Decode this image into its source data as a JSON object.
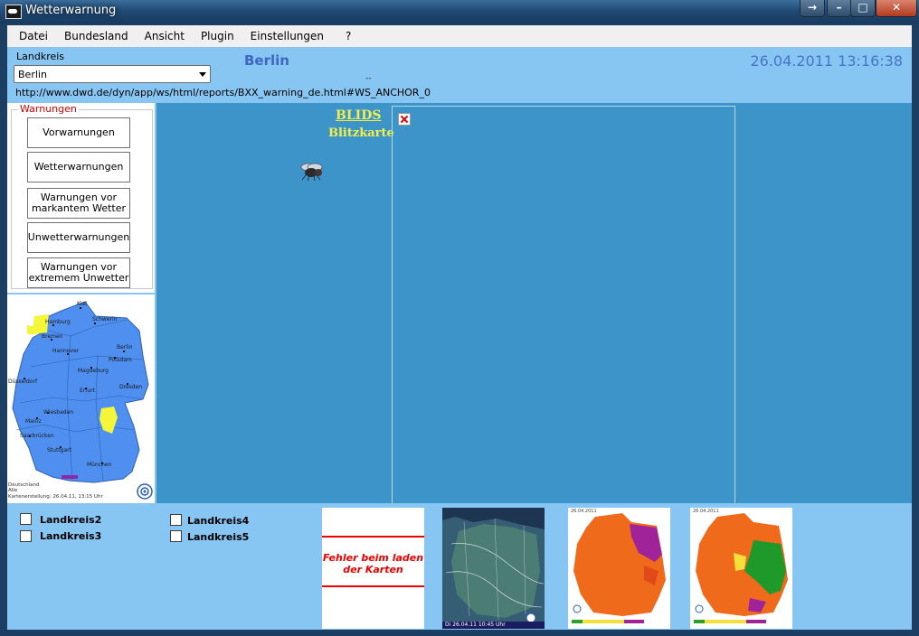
{
  "window": {
    "title": "Wetterwarnung",
    "buttons": [
      "→",
      "–",
      "□",
      "✕"
    ]
  },
  "menu": [
    "Datei",
    "Bundesland",
    "Ansicht",
    "Plugin",
    "Einstellungen",
    "?"
  ],
  "landkreis": {
    "label": "Landkreis",
    "selected": "Berlin"
  },
  "header": {
    "city": "Berlin",
    "datetime": "26.04.2011 13:16:38",
    "dots": "-- ",
    "url": "http://www.dwd.de/dyn/app/ws/html/reports/BXX_warning_de.html#WS_ANCHOR_0"
  },
  "warnings": {
    "legend": "Warnungen",
    "buttons": [
      "Vorwarnungen",
      "Wetterwarnungen",
      "Warnungen vor markantem Wetter",
      "Unwetterwarnungen",
      "Warnungen vor extremem Unwetter"
    ]
  },
  "map": {
    "cities": [
      "Kiel",
      "Hamburg",
      "Schwerin",
      "Bremen",
      "Hannover",
      "Berlin",
      "Potsdam",
      "Magdeburg",
      "Düsseldorf",
      "Erfurt",
      "Dresden",
      "Wiesbaden",
      "Mainz",
      "Saarbrücken",
      "Stuttgart",
      "München"
    ],
    "footer": [
      "Deutschland",
      "Alle",
      "Kartenerstellung: 26.04.11, 13:15 Uhr"
    ],
    "colors": {
      "land": "#4f8ff0",
      "warning": "#f5f53a"
    }
  },
  "web": {
    "link": "BLIDS",
    "subtitle": "Blitzkarte"
  },
  "landkreise": [
    "Landkreis2",
    "Landkreis3",
    "Landkreis4",
    "Landkreis5"
  ],
  "thumbnails": {
    "error": "Fehler beim laden der Karten",
    "satellite_stamp": "Di 26.04.11 10:45 Uhr",
    "map_date": "26.04.2011"
  }
}
